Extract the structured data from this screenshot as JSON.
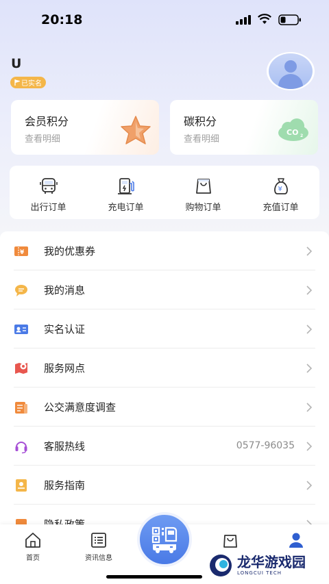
{
  "status_bar": {
    "time": "20:18"
  },
  "profile": {
    "username": "U",
    "verify_badge": "已实名"
  },
  "points": [
    {
      "title": "会员积分",
      "sub": "查看明细",
      "icon": "star-icon"
    },
    {
      "title": "碳积分",
      "sub": "查看明细",
      "icon": "co2-cloud-icon"
    }
  ],
  "orders": [
    {
      "label": "出行订单",
      "icon": "bus-icon"
    },
    {
      "label": "充电订单",
      "icon": "charging-pile-icon"
    },
    {
      "label": "购物订单",
      "icon": "shopping-bag-icon"
    },
    {
      "label": "充值订单",
      "icon": "money-bag-icon"
    }
  ],
  "menu": [
    {
      "label": "我的优惠券",
      "icon": "coupon-icon",
      "value": ""
    },
    {
      "label": "我的消息",
      "icon": "message-icon",
      "value": ""
    },
    {
      "label": "实名认证",
      "icon": "id-card-icon",
      "value": ""
    },
    {
      "label": "服务网点",
      "icon": "map-pin-icon",
      "value": ""
    },
    {
      "label": "公交满意度调查",
      "icon": "survey-icon",
      "value": ""
    },
    {
      "label": "客服热线",
      "icon": "headset-icon",
      "value": "0577-96035"
    },
    {
      "label": "服务指南",
      "icon": "guide-icon",
      "value": ""
    },
    {
      "label": "隐私政策",
      "icon": "privacy-icon",
      "value": ""
    }
  ],
  "tabbar": {
    "home": "首页",
    "news": "资讯信息",
    "shop": "",
    "mine": ""
  },
  "watermark": {
    "main": "龙华游戏园",
    "sub": "LONGCUI TECH"
  },
  "colors": {
    "accent": "#4a7ae6",
    "badge": "#f4b649",
    "icon_orange": "#f08a3c"
  }
}
